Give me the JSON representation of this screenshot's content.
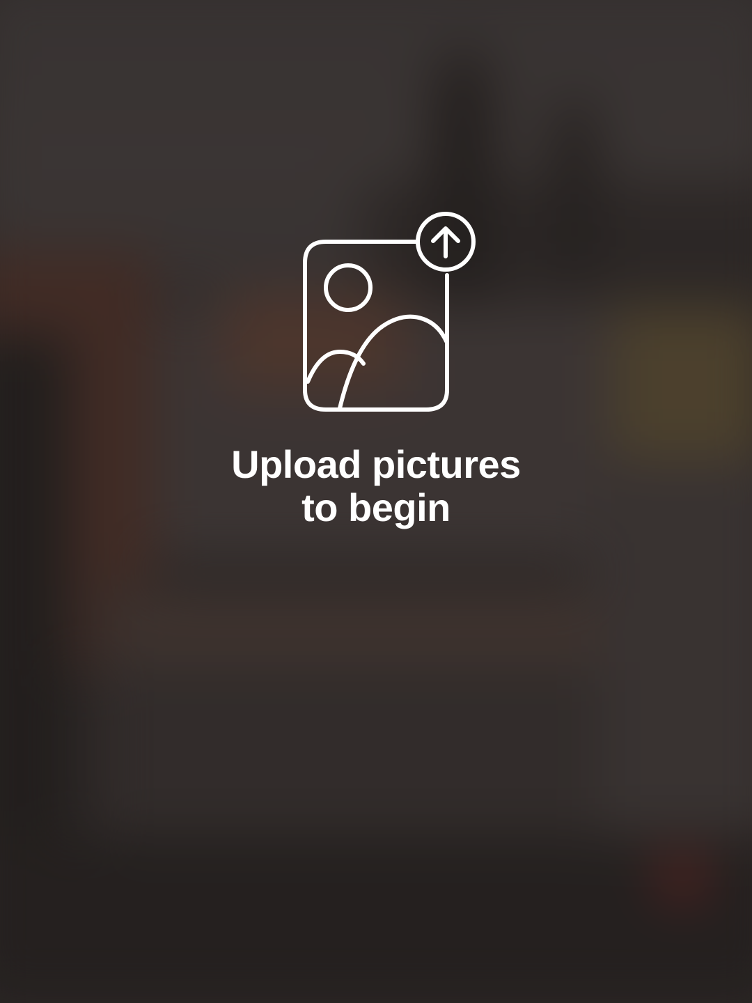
{
  "prompt": {
    "line1": "Upload pictures",
    "line2": "to begin",
    "icon": "image-upload-icon"
  },
  "colors": {
    "foreground": "#ffffff",
    "background": "#3a3331"
  }
}
